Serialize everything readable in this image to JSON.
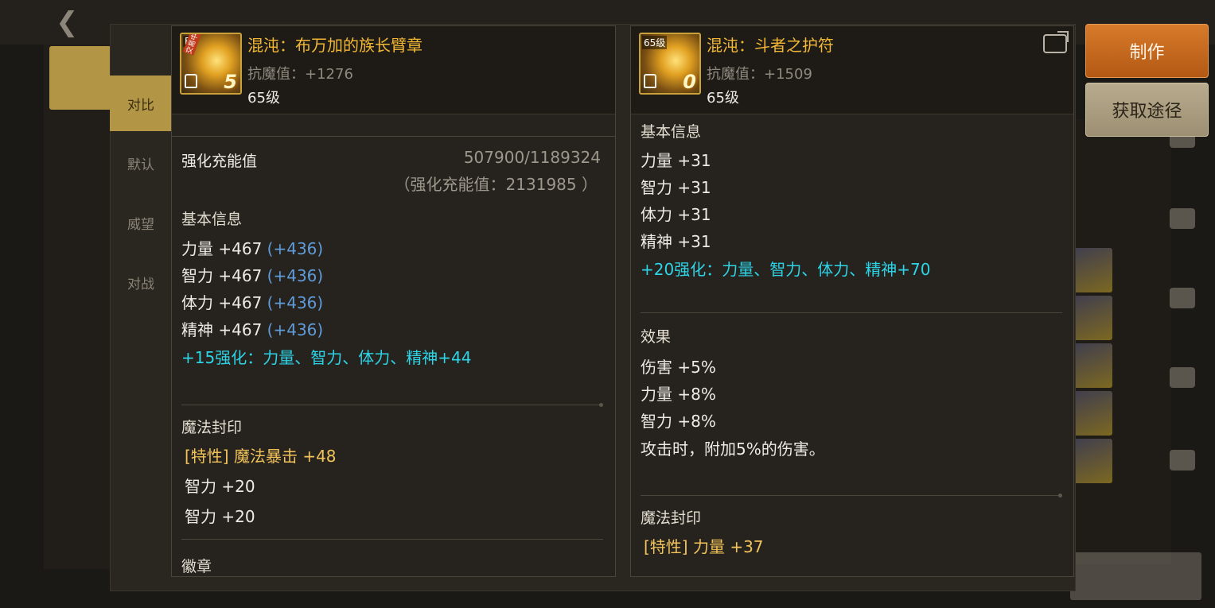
{
  "side_tabs": [
    "对比",
    "默认",
    "威望",
    "对战"
  ],
  "left_item": {
    "icon_badge": "F",
    "icon_stamp": "交易中",
    "icon_enhance": "5",
    "name": "混沌：布万加的族长臂章",
    "resistance": "抗魔值：+1276",
    "level": "65级",
    "charge_label": "强化充能值",
    "charge_value": "507900/1189324",
    "charge_total": "（强化充能值：2131985 ）",
    "basic_title": "基本信息",
    "stats": [
      {
        "name": "力量 +467",
        "bonus": "(+436)"
      },
      {
        "name": "智力 +467",
        "bonus": "(+436)"
      },
      {
        "name": "体力 +467",
        "bonus": "(+436)"
      },
      {
        "name": "精神 +467",
        "bonus": "(+436)"
      }
    ],
    "enhance_line": "+15强化：力量、智力、体力、精神+44",
    "seal_title": "魔法封印",
    "seal_lines": [
      "[特性] 魔法暴击 +48",
      "智力 +20",
      "智力 +20"
    ],
    "emblem_title": "徽章"
  },
  "right_item": {
    "icon_badge": "65级",
    "icon_enhance": "0",
    "name": "混沌：斗者之护符",
    "resistance": "抗魔值：+1509",
    "level": "65级",
    "basic_title": "基本信息",
    "stats": [
      "力量 +31",
      "智力 +31",
      "体力 +31",
      "精神 +31"
    ],
    "enhance_line": "+20强化：力量、智力、体力、精神+70",
    "effect_title": "效果",
    "effects": [
      "伤害 +5%",
      "力量 +8%",
      "智力 +8%",
      "攻击时，附加5%的伤害。"
    ],
    "seal_title": "魔法封印",
    "seal_line": "[特性] 力量 +37"
  },
  "buttons": {
    "make": "制作",
    "source": "获取途径"
  },
  "colors": {
    "accent_orange": "#c46a1f",
    "name_gold": "#f2b835",
    "bonus_blue": "#5f9bd9",
    "enhance_cyan": "#2dd4e8"
  }
}
